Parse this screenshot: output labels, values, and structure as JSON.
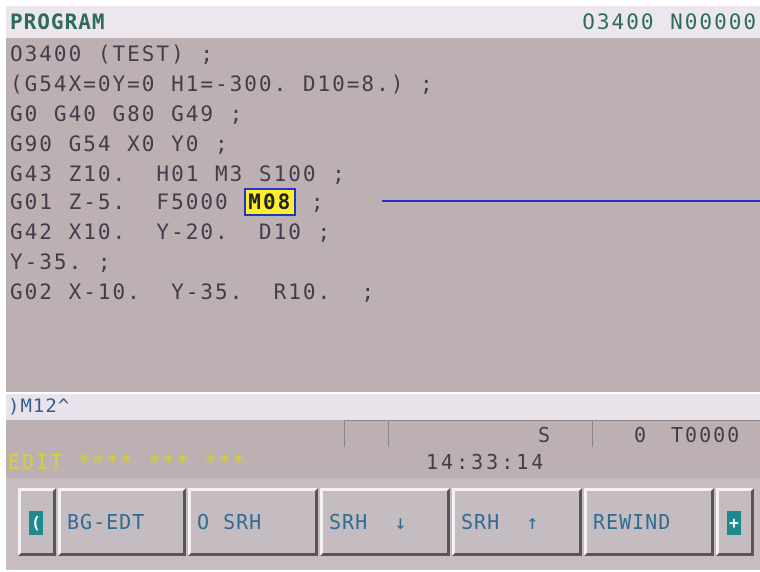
{
  "header": {
    "title": "PROGRAM",
    "program_number": "O3400",
    "sequence_number": "N00000"
  },
  "program": {
    "lines": [
      "O3400 (TEST) ;",
      "(G54X=0Y=0 H1=-300. D10=8.) ;",
      "G0 G40 G80 G49 ;",
      "G90 G54 X0 Y0 ;",
      "G43 Z10.  H01 M3 S100 ;",
      "G01 Z-5.  F5000 ",
      "G42 X10.  Y-20.  D10 ;",
      "Y-35. ;",
      "G02 X-10.  Y-35.  R10.  ;"
    ],
    "cursor_word": "M08",
    "cursor_line_suffix": " ;"
  },
  "input_line": {
    "text": ")M12^"
  },
  "status": {
    "spindle_label": "S",
    "spindle_value": "0",
    "tool": "T0000",
    "mode": "EDIT **** *** ***",
    "time": "14:33:14"
  },
  "softkeys": {
    "left_nav_icon": "left-bracket-icon",
    "right_nav_icon": "plus-icon",
    "left_glyph": "(",
    "right_glyph": "+",
    "keys": [
      "BG-EDT",
      "O SRH",
      "SRH  ↓",
      "SRH  ↑",
      "REWIND"
    ]
  },
  "colors": {
    "screen_bg": "#bdb0b3",
    "title_text": "#2e6c58",
    "cursor_highlight": "#ffee2e",
    "cursor_border": "#1d37c4",
    "mode_text": "#d6cf35",
    "softkey_text": "#2f6c92",
    "nav_icon": "#1d8a8d"
  }
}
